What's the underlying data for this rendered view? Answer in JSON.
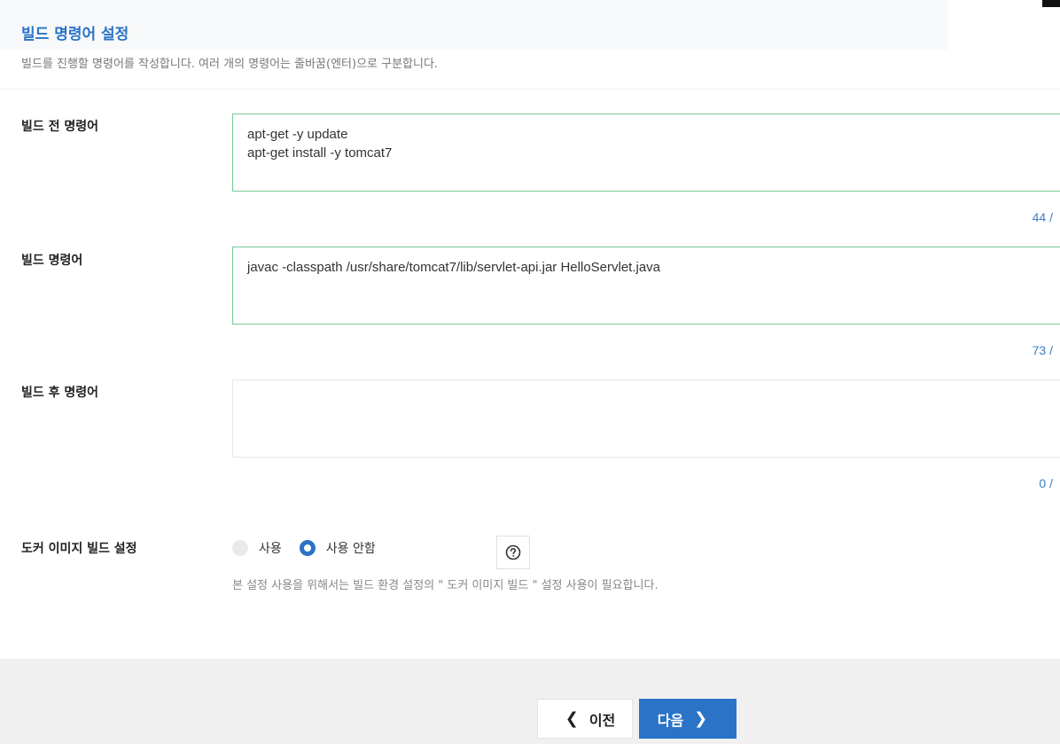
{
  "header": {
    "title": "빌드 명령어 설정",
    "description": "빌드를 진행할 명령어를 작성합니다. 여러 개의 명령어는 줄바꿈(엔터)으로 구분합니다."
  },
  "pre_build": {
    "label": "빌드 전 명령어",
    "value": "apt-get -y update\napt-get install -y tomcat7",
    "counter": "44 /"
  },
  "build": {
    "label": "빌드 명령어",
    "value": "javac -classpath /usr/share/tomcat7/lib/servlet-api.jar HelloServlet.java",
    "counter": "73 /"
  },
  "post_build": {
    "label": "빌드 후 명령어",
    "value": "",
    "counter": "0 /"
  },
  "docker": {
    "label": "도커 이미지 빌드 설정",
    "option_use": "사용",
    "option_not_use": "사용 안함",
    "selected": "사용 안함",
    "hint": "본 설정 사용을 위해서는 빌드 환경 설정의  \" 도커 이미지 빌드 \"  설정 사용이 필요합니다."
  },
  "footer": {
    "prev_label": "이전",
    "next_label": "다음"
  },
  "icons": {
    "help": "help-circle-icon",
    "prev": "chevron-left-icon",
    "next": "chevron-right-icon"
  },
  "colors": {
    "accent": "#2a73c6",
    "input_border_active": "#76c996",
    "counter": "#3b7fc4"
  }
}
